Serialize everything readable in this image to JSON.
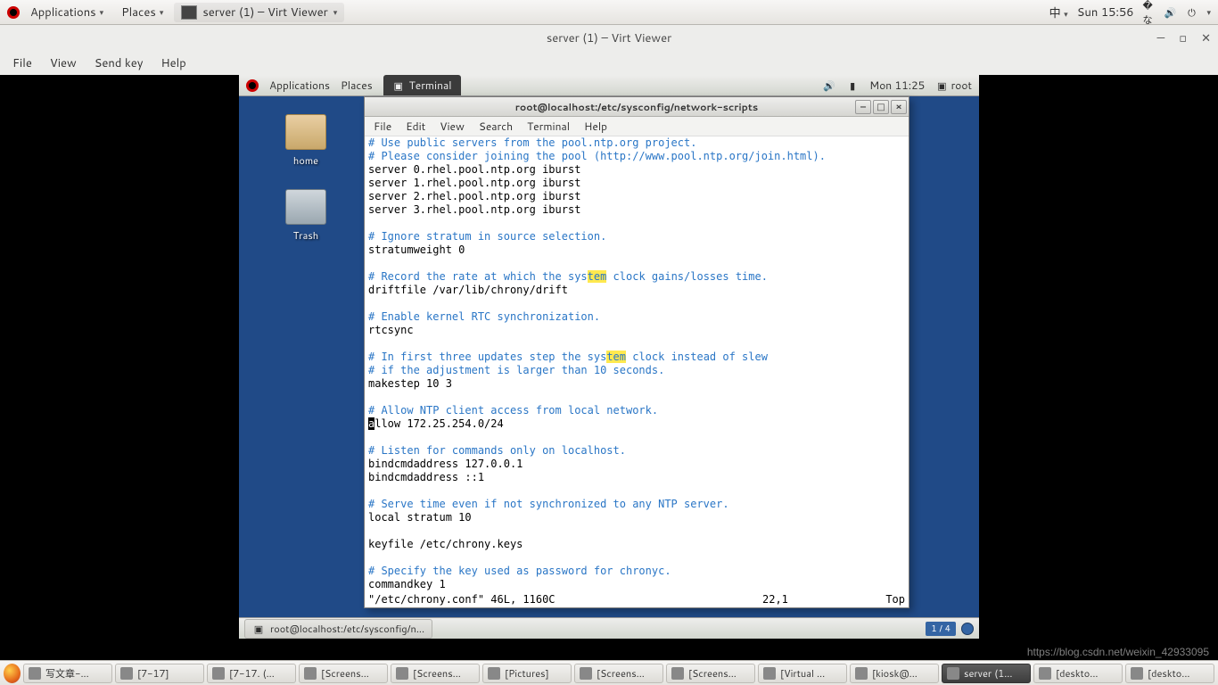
{
  "host_topbar": {
    "applications": "Applications",
    "places": "Places",
    "running_app": "server (1) – Virt Viewer",
    "ime": "中",
    "clock": "Sun 15:56"
  },
  "virt_viewer": {
    "title": "server (1) – Virt Viewer",
    "menu": {
      "file": "File",
      "view": "View",
      "sendkey": "Send key",
      "help": "Help"
    }
  },
  "guest_topbar": {
    "applications": "Applications",
    "places": "Places",
    "active": "Terminal",
    "clock": "Mon 11:25",
    "user": "root"
  },
  "desktop": {
    "home": "home",
    "trash": "Trash"
  },
  "terminal": {
    "title": "root@localhost:/etc/sysconfig/network-scripts",
    "menu": {
      "file": "File",
      "edit": "Edit",
      "view": "View",
      "search": "Search",
      "terminal": "Terminal",
      "help": "Help"
    },
    "lines": [
      {
        "t": "# Use public servers from the pool.ntp.org project.",
        "c": true
      },
      {
        "t": "# Please consider joining the pool (http://www.pool.ntp.org/join.html).",
        "c": true
      },
      {
        "t": "server 0.rhel.pool.ntp.org iburst"
      },
      {
        "t": "server 1.rhel.pool.ntp.org iburst"
      },
      {
        "t": "server 2.rhel.pool.ntp.org iburst"
      },
      {
        "t": "server 3.rhel.pool.ntp.org iburst"
      },
      {
        "t": ""
      },
      {
        "t": "# Ignore stratum in source selection.",
        "c": true
      },
      {
        "t": "stratumweight 0"
      },
      {
        "t": ""
      },
      {
        "seg": [
          {
            "t": "# Record the rate at which the sys",
            "c": true
          },
          {
            "t": "tem",
            "c": true,
            "hl": true
          },
          {
            "t": " clock gains/losses time.",
            "c": true
          }
        ]
      },
      {
        "t": "driftfile /var/lib/chrony/drift"
      },
      {
        "t": ""
      },
      {
        "t": "# Enable kernel RTC synchronization.",
        "c": true
      },
      {
        "t": "rtcsync"
      },
      {
        "t": ""
      },
      {
        "seg": [
          {
            "t": "# In first three updates step the sys",
            "c": true
          },
          {
            "t": "tem",
            "c": true,
            "hl": true
          },
          {
            "t": " clock instead of slew",
            "c": true
          }
        ]
      },
      {
        "t": "# if the adjustment is larger than 10 seconds.",
        "c": true
      },
      {
        "t": "makestep 10 3"
      },
      {
        "t": ""
      },
      {
        "t": "# Allow NTP client access from local network.",
        "c": true
      },
      {
        "seg": [
          {
            "t": "a",
            "cur": true
          },
          {
            "t": "llow 172.25.254.0/24"
          }
        ]
      },
      {
        "t": ""
      },
      {
        "t": "# Listen for commands only on localhost.",
        "c": true
      },
      {
        "t": "bindcmdaddress 127.0.0.1"
      },
      {
        "t": "bindcmdaddress ::1"
      },
      {
        "t": ""
      },
      {
        "t": "# Serve time even if not synchronized to any NTP server.",
        "c": true
      },
      {
        "t": "local stratum 10"
      },
      {
        "t": ""
      },
      {
        "t": "keyfile /etc/chrony.keys"
      },
      {
        "t": ""
      },
      {
        "t": "# Specify the key used as password for chronyc.",
        "c": true
      },
      {
        "t": "commandkey 1"
      }
    ],
    "status": {
      "file": "\"/etc/chrony.conf\" 46L, 1160C",
      "pos": "22,1",
      "scroll": "Top"
    }
  },
  "guest_bottombar": {
    "task": "root@localhost:/etc/sysconfig/n...",
    "workspace": "1 / 4"
  },
  "host_bottombar": {
    "tasks": [
      "写文章-...",
      "[7-17]",
      "[7-17. (...",
      "[Screens...",
      "[Screens...",
      "[Pictures]",
      "[Screens...",
      "[Screens...",
      "[Virtual ...",
      "[kiosk@...",
      "server (1...",
      "[deskto...",
      "[deskto..."
    ]
  },
  "watermark": "https://blog.csdn.net/weixin_42933095"
}
